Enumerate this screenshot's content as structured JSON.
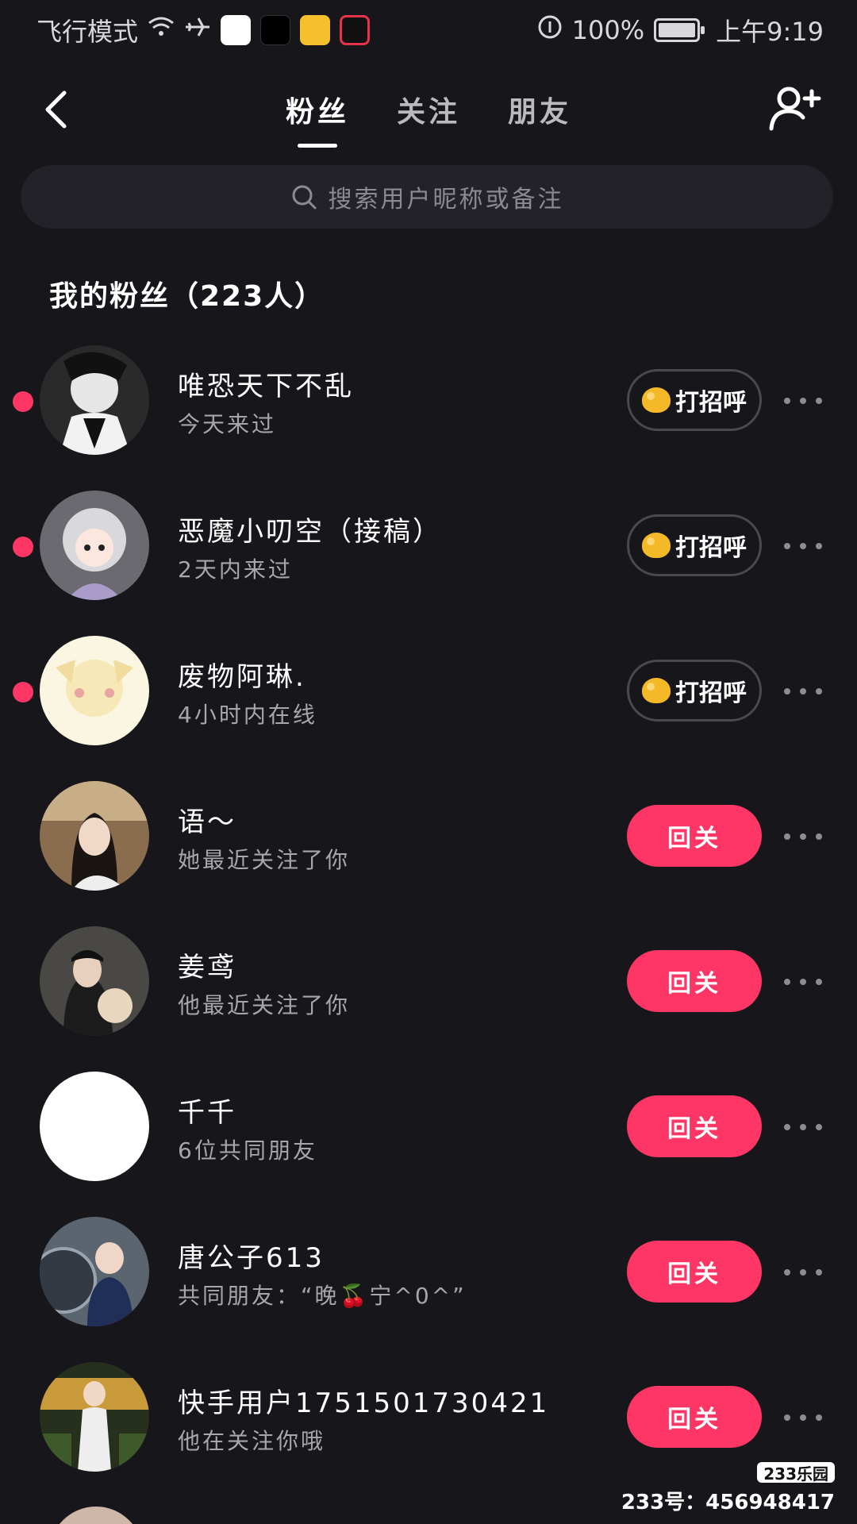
{
  "status_bar": {
    "mode": "飞行模式",
    "battery": "100%",
    "time": "上午9:19"
  },
  "header": {
    "tabs": [
      {
        "label": "粉丝",
        "active": true
      },
      {
        "label": "关注",
        "active": false
      },
      {
        "label": "朋友",
        "active": false
      }
    ]
  },
  "search": {
    "placeholder": "搜索用户昵称或备注"
  },
  "section": {
    "title": "我的粉丝（223人）"
  },
  "colors": {
    "accent": "#fe3666",
    "background": "#17161b"
  },
  "followers": [
    {
      "name": "唯恐天下不乱",
      "status": "今天来过",
      "action": "打招呼",
      "action_type": "greet",
      "unread": true
    },
    {
      "name": "恶魔小叨空（接稿）",
      "status": "2天内来过",
      "action": "打招呼",
      "action_type": "greet",
      "unread": true
    },
    {
      "name": "废物阿琳.",
      "status": "4小时内在线",
      "action": "打招呼",
      "action_type": "greet",
      "unread": true
    },
    {
      "name": "语～",
      "status": "她最近关注了你",
      "action": "回关",
      "action_type": "follow-back",
      "unread": false
    },
    {
      "name": "姜鸢",
      "status": "他最近关注了你",
      "action": "回关",
      "action_type": "follow-back",
      "unread": false
    },
    {
      "name": "千千",
      "status": "6位共同朋友",
      "action": "回关",
      "action_type": "follow-back",
      "unread": false
    },
    {
      "name": "唐公子613",
      "status": "共同朋友：“晚🍒宁^0^”",
      "action": "回关",
      "action_type": "follow-back",
      "unread": false
    },
    {
      "name": "快手用户1751501730421",
      "status": "他在关注你哦",
      "action": "回关",
      "action_type": "follow-back",
      "unread": false
    }
  ],
  "watermark": {
    "logo": "233乐园",
    "id": "233号：456948417"
  }
}
